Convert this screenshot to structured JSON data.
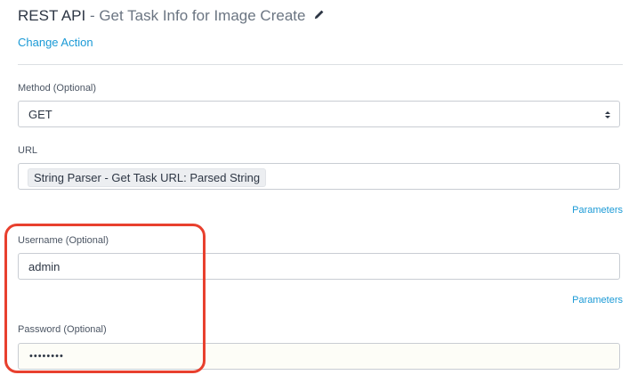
{
  "header": {
    "title_main": "REST API",
    "title_separator": " - ",
    "title_sub": "Get Task Info for Image Create",
    "edit_icon": "pencil-icon",
    "change_action_label": "Change Action"
  },
  "form": {
    "method": {
      "label": "Method (Optional)",
      "value": "GET",
      "icon": "select-arrows-icon"
    },
    "url": {
      "label": "URL",
      "token": "String Parser - Get Task URL: Parsed String",
      "parameters_label": "Parameters"
    },
    "username": {
      "label": "Username (Optional)",
      "value": "admin",
      "parameters_label": "Parameters"
    },
    "password": {
      "label": "Password (Optional)",
      "value": "••••••••"
    }
  },
  "annotation": {
    "highlight_color": "#e8402e"
  },
  "colors": {
    "link": "#1b9ad6",
    "text": "#2d3644",
    "muted": "#6b7582"
  }
}
